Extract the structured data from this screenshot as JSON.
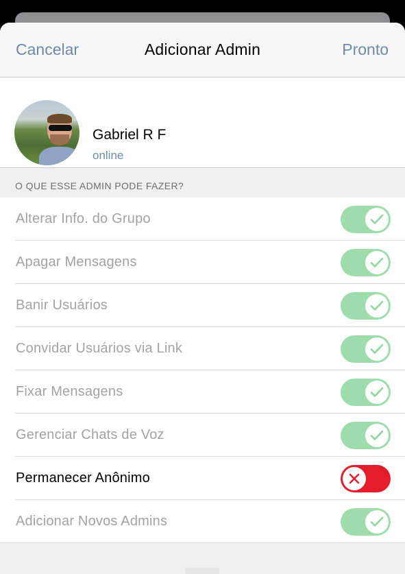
{
  "navbar": {
    "cancel_label": "Cancelar",
    "title": "Adicionar Admin",
    "done_label": "Pronto"
  },
  "profile": {
    "name": "Gabriel R F",
    "status": "online"
  },
  "permissions": {
    "section_header": "O QUE ESSE ADMIN PODE FAZER?",
    "items": [
      {
        "label": "Alterar Info. do Grupo",
        "enabled": true
      },
      {
        "label": "Apagar Mensagens",
        "enabled": true
      },
      {
        "label": "Banir Usuários",
        "enabled": true
      },
      {
        "label": "Convidar Usuários via Link",
        "enabled": true
      },
      {
        "label": "Fixar Mensagens",
        "enabled": true
      },
      {
        "label": "Gerenciar Chats de Voz",
        "enabled": true
      },
      {
        "label": "Permanecer Anônimo",
        "enabled": false
      },
      {
        "label": "Adicionar Novos Admins",
        "enabled": true
      }
    ]
  },
  "colors": {
    "accent": "#6f8aa8",
    "toggle_on": "#9fdcab",
    "toggle_off": "#e51c2c",
    "highlight": "#f4f57a"
  },
  "icons": {
    "on_knob": "checkmark-icon",
    "off_knob": "x-icon"
  }
}
